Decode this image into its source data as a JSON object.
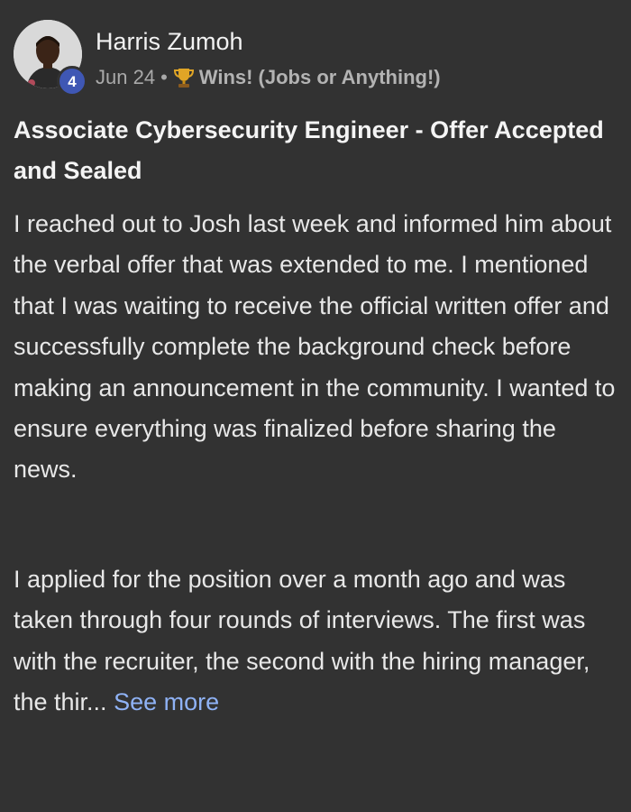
{
  "post": {
    "author": {
      "name": "Harris Zumoh",
      "level": "4",
      "avatar_icon": "profile-photo"
    },
    "meta": {
      "date": "Jun 24",
      "separator": "•",
      "category_icon": "trophy-icon",
      "category": "Wins! (Jobs or Anything!)"
    },
    "title": "Associate Cybersecurity Engineer - Offer Accepted and Sealed",
    "paragraphs": [
      "I reached out to Josh last week and informed him about the verbal offer that was extended to me. I mentioned that I was waiting to receive the official written offer and successfully complete the background check before making an announcement in the community. I wanted to ensure everything was finalized before sharing the news.",
      "I applied for the position over a month ago and was taken through four rounds of interviews. The first was with the recruiter, the second with the hiring manager, the thir..."
    ],
    "see_more": "See more"
  },
  "colors": {
    "background": "#323232",
    "badge": "#3f57b4",
    "link": "#8fb2f5",
    "trophy": "#e0a526"
  }
}
